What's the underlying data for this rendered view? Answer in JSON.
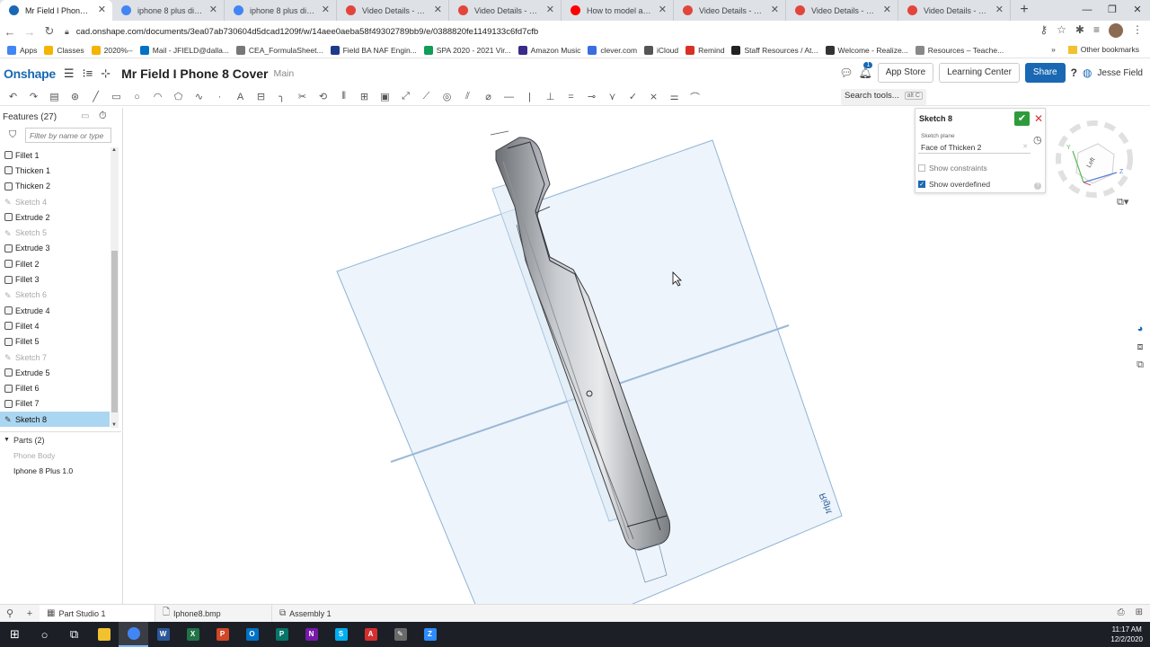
{
  "browser": {
    "tabs": [
      {
        "title": "Mr Field I Phone 8 Cover",
        "favicon": "onshape-icon",
        "color": "#1a68b3",
        "active": true
      },
      {
        "title": "iphone 8 plus dimensio",
        "favicon": "google-icon",
        "color": "#4285f4",
        "active": false
      },
      {
        "title": "iphone 8 plus dimensio",
        "favicon": "google-icon",
        "color": "#4285f4",
        "active": false
      },
      {
        "title": "Video Details - Screenc",
        "favicon": "screencast-icon",
        "color": "#e2453c",
        "active": false
      },
      {
        "title": "Video Details - Screenc",
        "favicon": "screencast-icon",
        "color": "#e2453c",
        "active": false
      },
      {
        "title": "How to model a 3D Pr",
        "favicon": "youtube-icon",
        "color": "#ff0000",
        "active": false
      },
      {
        "title": "Video Details - Screenc",
        "favicon": "screencast-icon",
        "color": "#e2453c",
        "active": false
      },
      {
        "title": "Video Details - Screenc",
        "favicon": "screencast-icon",
        "color": "#e2453c",
        "active": false
      },
      {
        "title": "Video Details - Screenc",
        "favicon": "screencast-icon",
        "color": "#e2453c",
        "active": false
      }
    ],
    "new_tab": "+",
    "url": "cad.onshape.com/documents/3ea07ab730604d5dcad1209f/w/14aee0aeba58f49302789bb9/e/0388820fe1149133c6fd7cfb",
    "bookmarks": [
      {
        "label": "Apps",
        "color": "#4285f4"
      },
      {
        "label": "Classes",
        "color": "#f4b400"
      },
      {
        "label": "2020%--",
        "color": "#f4b400"
      },
      {
        "label": "Mail - JFIELD@dalla...",
        "color": "#0072c6"
      },
      {
        "label": "CEA_FormulaSheet...",
        "color": "#777777"
      },
      {
        "label": "Field BA NAF Engin...",
        "color": "#1e3a8a"
      },
      {
        "label": "SPA 2020 - 2021 Vir...",
        "color": "#0f9d58"
      },
      {
        "label": "Amazon Music",
        "color": "#3a2a8a"
      },
      {
        "label": "clever.com",
        "color": "#3b6ce0"
      },
      {
        "label": "iCloud",
        "color": "#555555"
      },
      {
        "label": "Remind",
        "color": "#d93025"
      },
      {
        "label": "Staff Resources / At...",
        "color": "#222222"
      },
      {
        "label": "Welcome - Realize...",
        "color": "#333333"
      },
      {
        "label": "Resources – Teache...",
        "color": "#888888"
      }
    ],
    "bookmarks_more": "»",
    "other_bookmarks": "Other bookmarks"
  },
  "onshape": {
    "logo": "Onshape",
    "document_title": "Mr Field I Phone 8 Cover",
    "branch": "Main",
    "notification_count": "1",
    "app_store": "App Store",
    "learning_center": "Learning Center",
    "share": "Share",
    "help": "?",
    "user": "Jesse Field",
    "search_tools": "Search tools...",
    "search_shortcut": "alt C"
  },
  "features": {
    "header": "Features (27)",
    "filter_placeholder": "Filter by name or type",
    "items": [
      {
        "label": "Fillet 1",
        "kind": "feature"
      },
      {
        "label": "Thicken 1",
        "kind": "feature"
      },
      {
        "label": "Thicken 2",
        "kind": "feature"
      },
      {
        "label": "Sketch 4",
        "kind": "sketch"
      },
      {
        "label": "Extrude 2",
        "kind": "feature"
      },
      {
        "label": "Sketch 5",
        "kind": "sketch"
      },
      {
        "label": "Extrude 3",
        "kind": "feature"
      },
      {
        "label": "Fillet 2",
        "kind": "feature"
      },
      {
        "label": "Fillet 3",
        "kind": "feature"
      },
      {
        "label": "Sketch 6",
        "kind": "sketch"
      },
      {
        "label": "Extrude 4",
        "kind": "feature"
      },
      {
        "label": "Fillet 4",
        "kind": "feature"
      },
      {
        "label": "Fillet 5",
        "kind": "feature"
      },
      {
        "label": "Sketch 7",
        "kind": "sketch"
      },
      {
        "label": "Extrude 5",
        "kind": "feature"
      },
      {
        "label": "Fillet 6",
        "kind": "feature"
      },
      {
        "label": "Fillet 7",
        "kind": "feature"
      },
      {
        "label": "Sketch 8",
        "kind": "selected"
      }
    ],
    "parts_header": "Parts (2)",
    "parts": [
      {
        "label": "Phone Body",
        "dim": true
      },
      {
        "label": "Iphone 8 Plus 1.0",
        "dim": false
      }
    ]
  },
  "sketch_dialog": {
    "title": "Sketch 8",
    "plane_label": "Sketch plane",
    "plane_value": "Face of Thicken 2",
    "show_constraints": "Show constraints",
    "show_constraints_checked": false,
    "show_overdefined": "Show overdefined",
    "show_overdefined_checked": true
  },
  "viewport": {
    "plane_label": "Right",
    "viewcube_face": "Left",
    "triad": {
      "y": "Y",
      "z": "Z"
    }
  },
  "bottom_tabs": [
    {
      "label": "Part Studio 1",
      "icon": "part-studio-icon",
      "active": true
    },
    {
      "label": "Iphone8.bmp",
      "icon": "file-icon",
      "active": false
    },
    {
      "label": "Assembly 1",
      "icon": "assembly-icon",
      "active": false
    }
  ],
  "taskbar": {
    "time": "11:17 AM",
    "date": "12/2/2020",
    "apps": [
      {
        "name": "start-icon",
        "color": "#1c1f26",
        "glyph": "⊞"
      },
      {
        "name": "search-icon",
        "color": "#1c1f26",
        "glyph": "○"
      },
      {
        "name": "task-view-icon",
        "color": "#1c1f26",
        "glyph": "⧉"
      },
      {
        "name": "file-explorer-icon",
        "color": "#f2c12e",
        "glyph": ""
      },
      {
        "name": "chrome-icon",
        "color": "#4285f4",
        "glyph": "",
        "active": true
      },
      {
        "name": "word-icon",
        "color": "#2b579a",
        "glyph": "W"
      },
      {
        "name": "excel-icon",
        "color": "#217346",
        "glyph": "X"
      },
      {
        "name": "powerpoint-icon",
        "color": "#d24726",
        "glyph": "P"
      },
      {
        "name": "outlook-icon",
        "color": "#0072c6",
        "glyph": "O"
      },
      {
        "name": "publisher-icon",
        "color": "#077568",
        "glyph": "P"
      },
      {
        "name": "onenote-icon",
        "color": "#7719aa",
        "glyph": "N"
      },
      {
        "name": "skype-icon",
        "color": "#00aff0",
        "glyph": "S"
      },
      {
        "name": "acrobat-icon",
        "color": "#d32f2f",
        "glyph": "A"
      },
      {
        "name": "paint-icon",
        "color": "#6a6a6a",
        "glyph": "✎"
      },
      {
        "name": "zoom-icon",
        "color": "#2d8cff",
        "glyph": "Z"
      }
    ]
  }
}
